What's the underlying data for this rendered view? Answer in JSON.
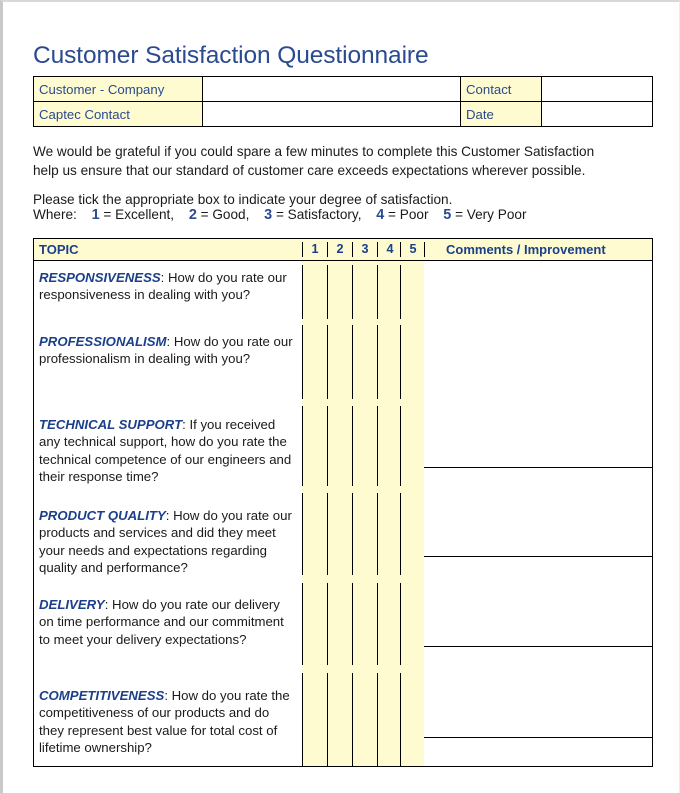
{
  "document": {
    "title": "Customer Satisfaction Questionnaire"
  },
  "header_table": {
    "rows": [
      {
        "label": "Customer  - Company",
        "value": "",
        "label2": "Contact",
        "value2": ""
      },
      {
        "label": "Captec Contact",
        "value": "",
        "label2": "Date",
        "value2": ""
      }
    ]
  },
  "intro": {
    "line1": "We would be grateful if you could spare a few minutes to complete this Customer Satisfaction",
    "line2": "help us ensure that our standard of customer care exceeds expectations wherever possible.",
    "line3": "Please tick the appropriate box to indicate your degree of satisfaction.",
    "where_label": "Where:",
    "scale": [
      {
        "num": "1",
        "text": "= Excellent,"
      },
      {
        "num": "2",
        "text": "= Good,"
      },
      {
        "num": "3",
        "text": "= Satisfactory,"
      },
      {
        "num": "4",
        "text": "= Poor"
      },
      {
        "num": "5",
        "text": "= Very Poor"
      }
    ]
  },
  "grid": {
    "topic_header": "TOPIC",
    "rating_columns": [
      "1",
      "2",
      "3",
      "4",
      "5"
    ],
    "comments_header": "Comments / Improvement",
    "questions": [
      {
        "keyword": "RESPONSIVENESS",
        "text": ": How do you rate our responsiveness in dealing with you?"
      },
      {
        "keyword": "PROFESSIONALISM",
        "text": ": How do you rate our professionalism in dealing with you?"
      },
      {
        "keyword": "TECHNICAL SUPPORT",
        "text": ": If you received any technical support, how do you rate the technical competence of our engineers and their response time?"
      },
      {
        "keyword": "PRODUCT QUALITY",
        "text": ": How do you rate our products and services and did they meet your needs and expectations regarding quality and performance?"
      },
      {
        "keyword": "DELIVERY",
        "text": ": How do you rate our delivery on time performance and our commitment to meet your delivery expectations?"
      },
      {
        "keyword": "COMPETITIVENESS",
        "text": ": How do you rate the competitiveness of our products and do they represent best value for total cost of lifetime ownership?"
      }
    ]
  },
  "colors": {
    "accent_blue": "#2a4a91",
    "heading_blue": "#1b3f8b",
    "pale_yellow": "#fdfbcf",
    "rule_black": "#000000"
  }
}
